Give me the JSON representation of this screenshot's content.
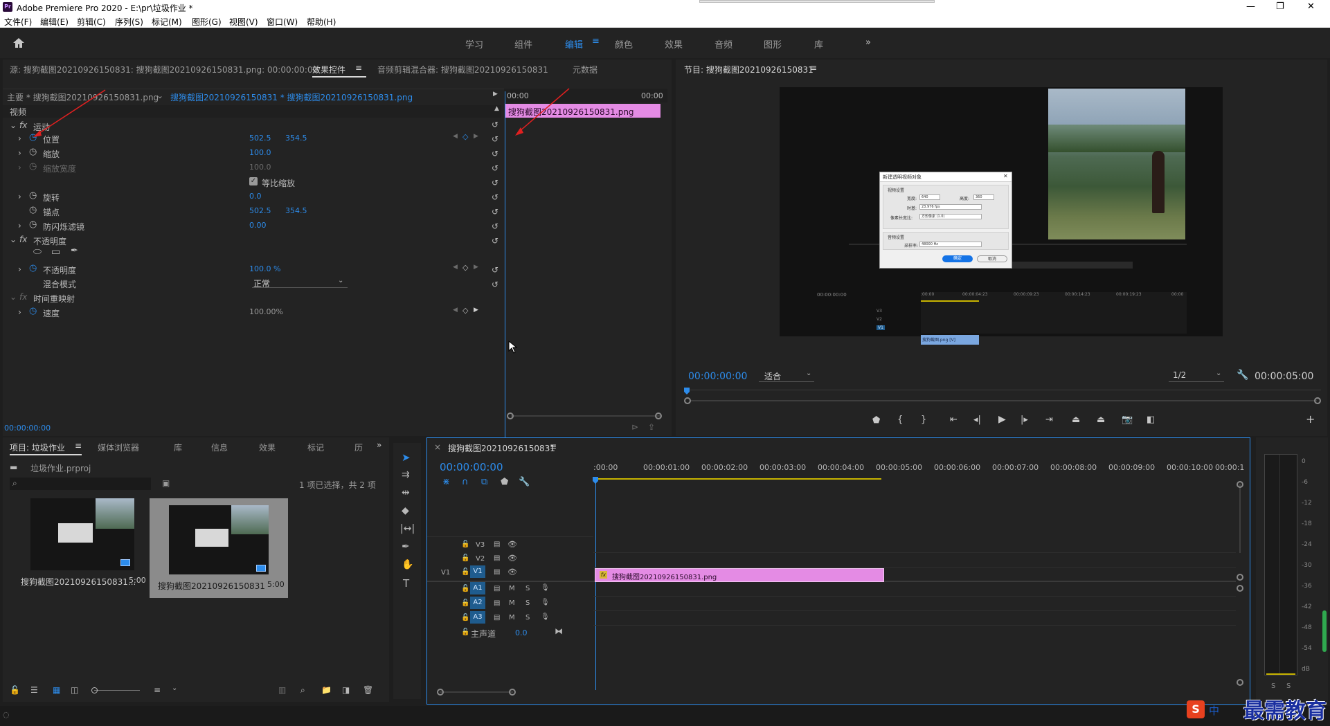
{
  "window": {
    "title": "Adobe Premiere Pro 2020 - E:\\pr\\垃圾作业 *",
    "app_icon": "Pr"
  },
  "menu": [
    "文件(F)",
    "编辑(E)",
    "剪辑(C)",
    "序列(S)",
    "标记(M)",
    "图形(G)",
    "视图(V)",
    "窗口(W)",
    "帮助(H)"
  ],
  "workspaces": [
    "学习",
    "组件",
    "编辑",
    "颜色",
    "效果",
    "音频",
    "图形",
    "库"
  ],
  "active_workspace": "编辑",
  "accent_color": "#2d8ceb",
  "clip_color": "#e48be4",
  "top_left_tabs": {
    "source": "源: 搜狗截图20210926150831: 搜狗截图20210926150831.png: 00:00:00:00",
    "effect_controls": "效果控件",
    "audio_mixer": "音频剪辑混合器: 搜狗截图20210926150831",
    "metadata": "元数据"
  },
  "effect_controls": {
    "master": "主要 * 搜狗截图20210926150831.png",
    "clip": "搜狗截图20210926150831 * 搜狗截图20210926150831.png",
    "video_header": "视频",
    "tl_start": "00:00",
    "tl_end": "00:00",
    "clip_bar": "搜狗截图20210926150831.png",
    "motion": "运动",
    "position": "位置",
    "position_x": "502.5",
    "position_y": "354.5",
    "scale": "缩放",
    "scale_val": "100.0",
    "scale_width": "缩放宽度",
    "scale_width_val": "100.0",
    "uniform_scale": "等比缩放",
    "rotation": "旋转",
    "rotation_val": "0.0",
    "anchor": "锚点",
    "anchor_x": "502.5",
    "anchor_y": "354.5",
    "anti_flicker": "防闪烁滤镜",
    "anti_flicker_val": "0.00",
    "opacity_group": "不透明度",
    "opacity": "不透明度",
    "opacity_val": "100.0 %",
    "blend_mode": "混合模式",
    "blend_val": "正常",
    "time_remap": "时间重映射",
    "speed": "速度",
    "speed_val": "100.00%",
    "timecode": "00:00:00:00"
  },
  "program": {
    "title": "节目: 搜狗截图20210926150831",
    "timecode": "00:00:00:00",
    "fit": "适合",
    "resolution": "1/2",
    "duration": "00:00:05:00"
  },
  "dialog": {
    "title": "新建透明视频对象",
    "video_settings": "视频设置",
    "width_label": "宽度:",
    "width_val": "640",
    "height_label": "高度:",
    "height_val": "360",
    "timebase_label": "时基:",
    "timebase_val": "23.976 fps",
    "par_label": "像素长宽比:",
    "par_val": "方形像素 (1.0)",
    "audio_settings": "音频设置",
    "samplerate_label": "采样率:",
    "samplerate_val": "48000 Hz",
    "ok": "确定",
    "cancel": "取消"
  },
  "mini_timeline": {
    "tc": "00:00:00:00",
    "ticks": [
      ":00:00",
      "00:00:04:23",
      "00:00:09:23",
      "00:00:14:23",
      "00:00:19:23",
      "00:00"
    ],
    "tracks": [
      "V3",
      "V2",
      "V1"
    ],
    "clip": "搜狗截图.png [V]"
  },
  "project": {
    "tabs": [
      "项目: 垃圾作业",
      "媒体浏览器",
      "库",
      "信息",
      "效果",
      "标记",
      "历"
    ],
    "file": "垃圾作业.prproj",
    "selection": "1 项已选择，共 2 项",
    "items": [
      {
        "name": "搜狗截图20210926150831...",
        "duration": "5:00"
      },
      {
        "name": "搜狗截图20210926150831",
        "duration": "5:00"
      }
    ]
  },
  "timeline": {
    "title": "搜狗截图20210926150831",
    "timecode": "00:00:00:00",
    "ruler": [
      ":00:00",
      "00:00:01:00",
      "00:00:02:00",
      "00:00:03:00",
      "00:00:04:00",
      "00:00:05:00",
      "00:00:06:00",
      "00:00:07:00",
      "00:00:08:00",
      "00:00:09:00",
      "00:00:10:00",
      "00:00:1"
    ],
    "video_tracks": [
      "V3",
      "V2",
      "V1"
    ],
    "audio_tracks": [
      "A1",
      "A2",
      "A3"
    ],
    "source_patch": "V1",
    "master": "主声道",
    "master_val": "0.0",
    "clip": "搜狗截图20210926150831.png",
    "m": "M",
    "s": "S"
  },
  "meters": {
    "labels": [
      "0",
      "-6",
      "-12",
      "-18",
      "-24",
      "-30",
      "-36",
      "-42",
      "-48",
      "-54",
      "dB"
    ],
    "solo": [
      "S",
      "S"
    ]
  },
  "watermark": "最需教育",
  "ime": "中"
}
